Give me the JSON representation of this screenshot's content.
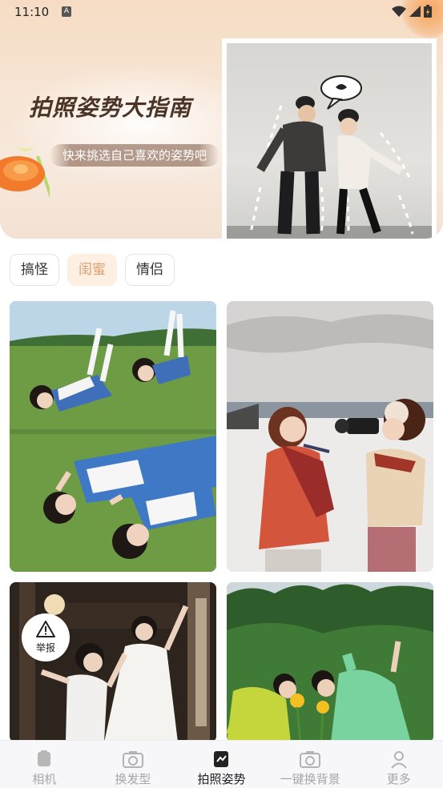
{
  "status_bar": {
    "time": "11:10",
    "notification_letter": "A",
    "icons": [
      "wifi-icon",
      "signal-icon",
      "battery-charging-icon"
    ]
  },
  "banner": {
    "title": "拍照姿势大指南",
    "subtitle": "快来挑选自己喜欢的姿势吧",
    "photo_icon": "couple-pose-photo"
  },
  "tabs": [
    {
      "label": "搞怪",
      "active": false
    },
    {
      "label": "闺蜜",
      "active": true
    },
    {
      "label": "情侣",
      "active": false
    }
  ],
  "photos": [
    {
      "icon": "girls-on-grass-photo"
    },
    {
      "icon": "girls-in-snow-camera-photo"
    },
    {
      "icon": "girls-in-doorway-photo"
    },
    {
      "icon": "girls-in-garden-photo"
    }
  ],
  "report": {
    "label": "举报",
    "icon": "warning-triangle-icon"
  },
  "bottom_nav": [
    {
      "label": "相机",
      "icon": "camera-square-icon",
      "active": false
    },
    {
      "label": "换发型",
      "icon": "camera-icon",
      "active": false
    },
    {
      "label": "拍照姿势",
      "icon": "pose-chart-icon",
      "active": true
    },
    {
      "label": "一键换背景",
      "icon": "camera-icon",
      "active": false
    },
    {
      "label": "更多",
      "icon": "person-icon",
      "active": false
    }
  ],
  "colors": {
    "accent_tab_bg": "#fdefe2",
    "accent_tab_text": "#e0a06f",
    "nav_active": "#222222",
    "nav_inactive": "#a6a6a6"
  }
}
